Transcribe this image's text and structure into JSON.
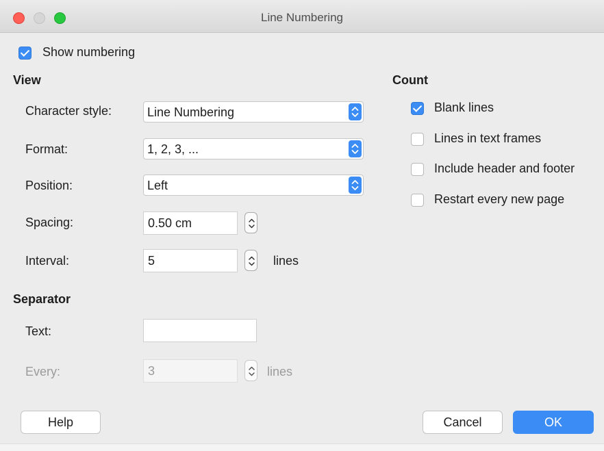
{
  "window": {
    "title": "Line Numbering"
  },
  "show_numbering": {
    "label": "Show numbering",
    "checked": true
  },
  "view": {
    "heading": "View",
    "character_style": {
      "label": "Character style:",
      "value": "Line Numbering"
    },
    "format": {
      "label": "Format:",
      "value": "1, 2, 3, ..."
    },
    "position": {
      "label": "Position:",
      "value": "Left"
    },
    "spacing": {
      "label": "Spacing:",
      "value": "0.50 cm"
    },
    "interval": {
      "label": "Interval:",
      "value": "5",
      "unit": "lines"
    }
  },
  "separator": {
    "heading": "Separator",
    "text": {
      "label": "Text:",
      "value": ""
    },
    "every": {
      "label": "Every:",
      "value": "3",
      "unit": "lines"
    }
  },
  "count": {
    "heading": "Count",
    "items": [
      {
        "label": "Blank lines",
        "checked": true
      },
      {
        "label": "Lines in text frames",
        "checked": false
      },
      {
        "label": "Include header and footer",
        "checked": false
      },
      {
        "label": "Restart every new page",
        "checked": false
      }
    ]
  },
  "buttons": {
    "help": "Help",
    "cancel": "Cancel",
    "ok": "OK"
  },
  "colors": {
    "accent": "#3b8df5",
    "window_bg": "#ececec",
    "disabled_text": "#9b9b9b"
  },
  "icons": [
    "close-light",
    "minimize-light",
    "zoom-light",
    "checkmark-icon",
    "up-down-chevron-icon"
  ]
}
